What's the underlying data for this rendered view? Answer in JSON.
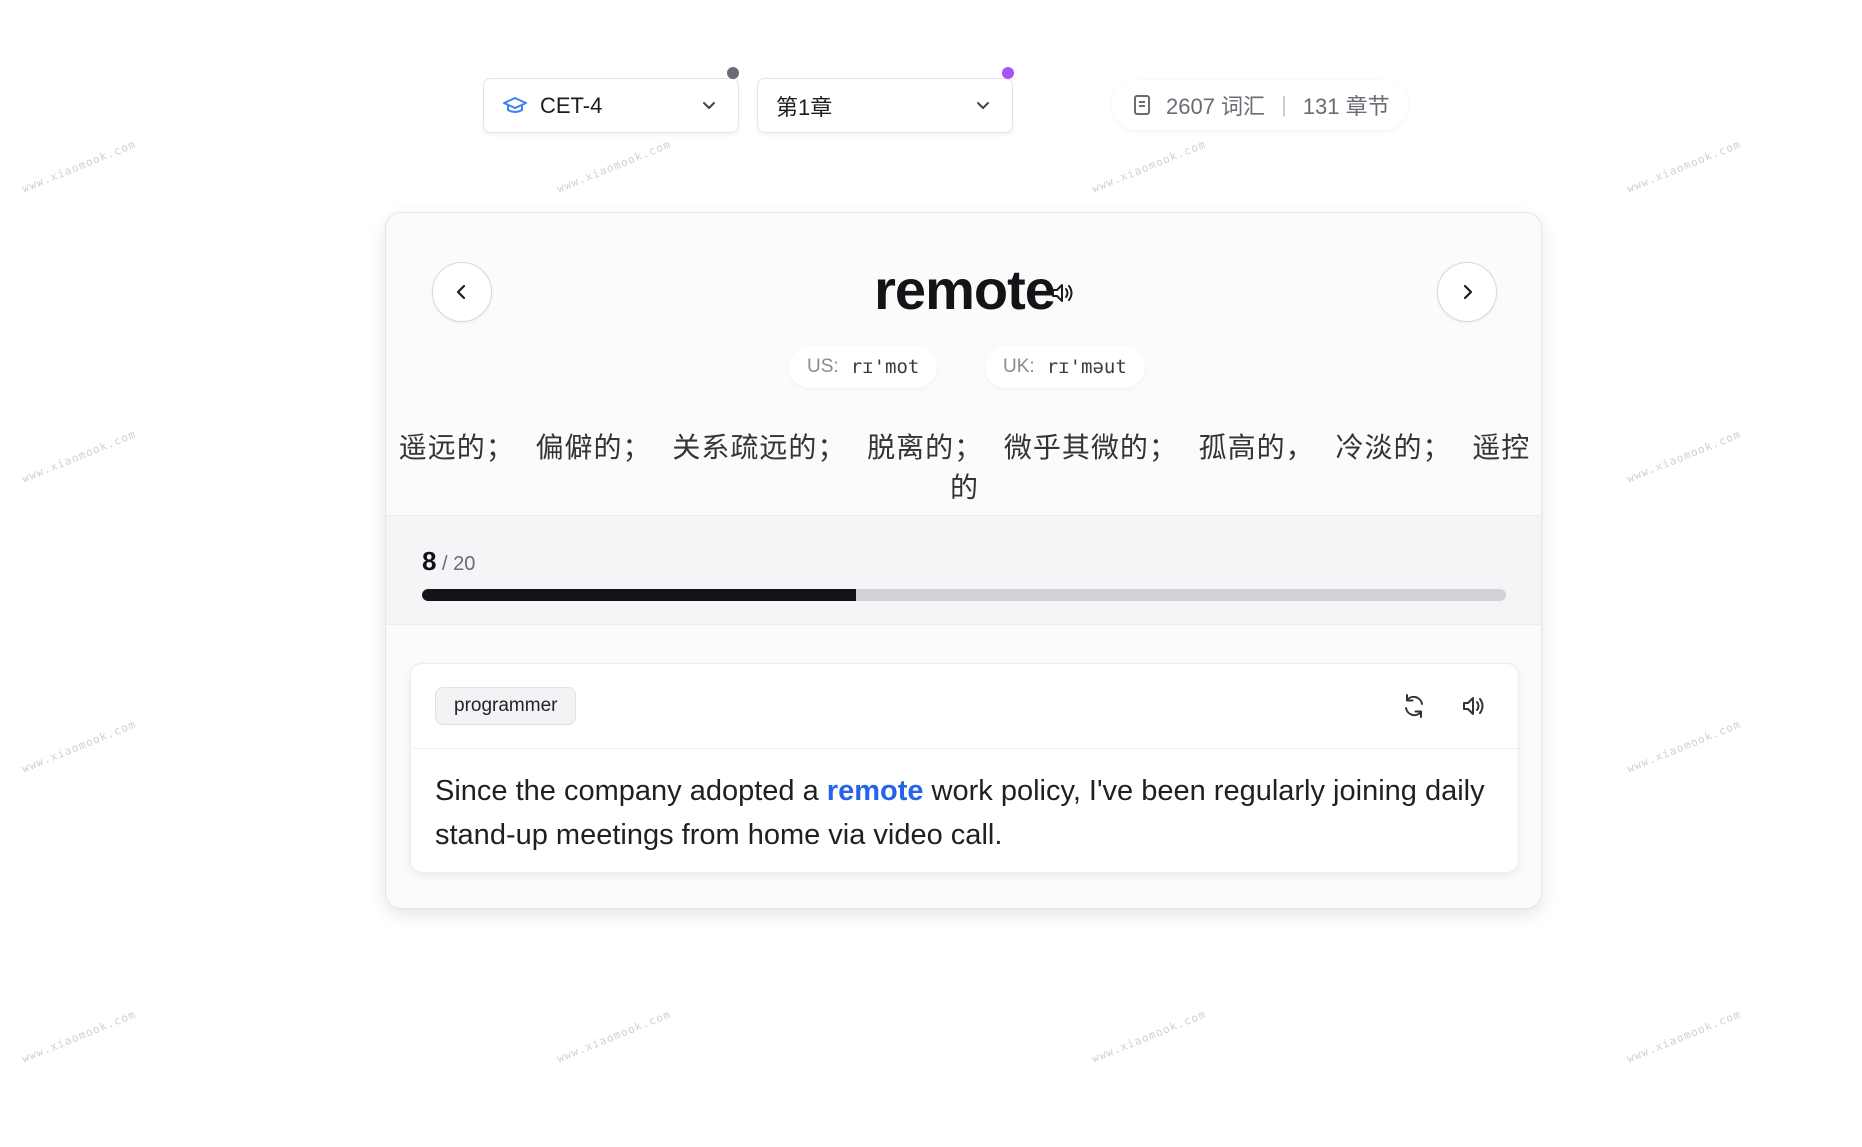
{
  "header": {
    "level_select": {
      "value": "CET-4",
      "icon": "graduation-cap-icon",
      "accent": "#3b82f6",
      "status_color": "#6b6b74"
    },
    "chapter_select": {
      "value": "第1章",
      "status_color": "#a855f7"
    },
    "stats": {
      "words": "2607 词汇",
      "separator": "|",
      "chapters": "131 章节",
      "icon": "book-icon"
    }
  },
  "card": {
    "word": "remote",
    "pronunciations": [
      {
        "label": "US:",
        "ipa": "rɪ'mot"
      },
      {
        "label": "UK:",
        "ipa": "rɪ'məut"
      }
    ],
    "meaning": "遥远的； 偏僻的； 关系疏远的； 脱离的； 微乎其微的； 孤高的， 冷淡的； 遥控的",
    "progress": {
      "current": "8",
      "total": "/ 20",
      "fraction": 0.4
    },
    "example": {
      "tag": "programmer",
      "sentence_before": "Since the company adopted a ",
      "highlight": "remote",
      "sentence_after": " work policy, I've been regularly joining daily stand-up meetings from home via video call.",
      "highlight_color": "#2563eb"
    }
  },
  "watermark": "www.xiaomook.com"
}
